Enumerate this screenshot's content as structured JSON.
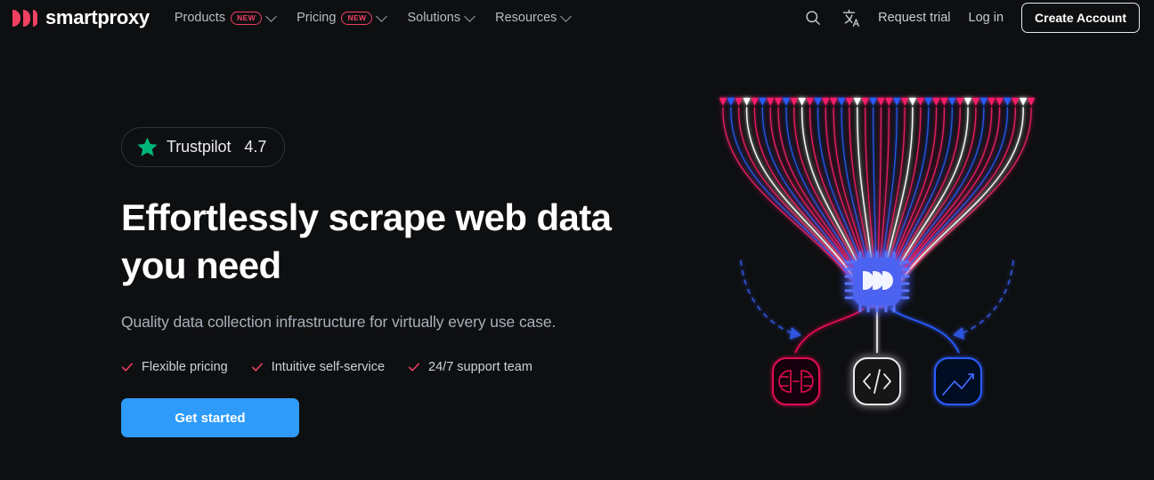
{
  "brand": {
    "name": "smartproxy",
    "logo_color": "#ef4062"
  },
  "header": {
    "nav": [
      {
        "label": "Products",
        "badge": "NEW",
        "has_dropdown": true
      },
      {
        "label": "Pricing",
        "badge": "NEW",
        "has_dropdown": true
      },
      {
        "label": "Solutions",
        "badge": "",
        "has_dropdown": true
      },
      {
        "label": "Resources",
        "badge": "",
        "has_dropdown": true
      }
    ],
    "search_icon": "search-icon",
    "language_icon": "translate-icon",
    "request_trial": "Request trial",
    "log_in": "Log in",
    "create_account": "Create Account"
  },
  "hero": {
    "trustpilot": {
      "icon": "star-icon",
      "name": "Trustpilot",
      "score": "4.7",
      "star_color": "#00b67a"
    },
    "title": "Effortlessly scrape web data you need",
    "subtitle": "Quality data collection infrastructure for virtually every use case.",
    "features": [
      {
        "icon": "check-icon",
        "label": "Flexible pricing"
      },
      {
        "icon": "check-icon",
        "label": "Intuitive self-service"
      },
      {
        "icon": "check-icon",
        "label": "24/7 support team"
      }
    ],
    "cta_label": "Get started",
    "cta_color": "#2e9bfb",
    "check_color": "#ef4062"
  },
  "artwork": {
    "name": "data-funnel-illustration",
    "chip_icon": "smartproxy-chip-icon",
    "node_icons": [
      {
        "name": "plug-connector-icon",
        "color": "#e01050"
      },
      {
        "name": "code-brackets-icon",
        "color": "#ffffff"
      },
      {
        "name": "line-chart-icon",
        "color": "#2b5cff"
      }
    ],
    "stream_colors": [
      "#ff1f6b",
      "#2b5cff",
      "#ffffff"
    ]
  },
  "theme": {
    "background": "#0e0f11",
    "text_primary": "#ffffff",
    "text_muted": "#a9b0ba"
  }
}
